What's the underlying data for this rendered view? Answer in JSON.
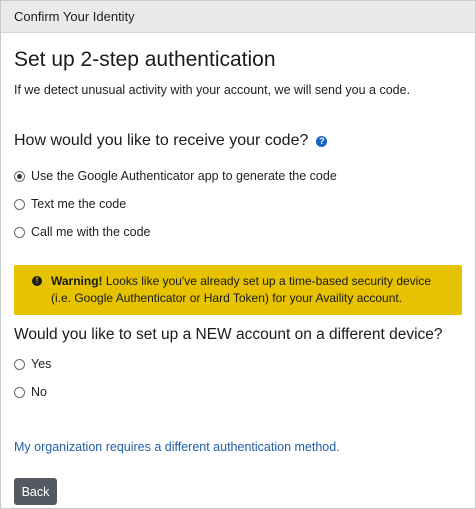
{
  "window": {
    "title": "Confirm Your Identity"
  },
  "header": {
    "title": "Set up 2-step authentication",
    "subtitle": "If we detect unusual activity with your account, we will send you a code."
  },
  "delivery": {
    "question": "How would you like to receive your code?",
    "help_icon": "question-circle-icon",
    "options": [
      {
        "label": "Use the Google Authenticator app to generate the code",
        "checked": true
      },
      {
        "label": "Text me the code",
        "checked": false
      },
      {
        "label": "Call me with the code",
        "checked": false
      }
    ]
  },
  "warning": {
    "icon": "exclamation-circle-icon",
    "strong": "Warning!",
    "text": " Looks like you've already set up a time-based security device (i.e. Google Authenticator or Hard Token) for your Availity account.",
    "color": "#e6c200"
  },
  "new_device": {
    "question": "Would you like to set up a NEW account on a different device?",
    "options": [
      {
        "label": "Yes",
        "checked": false
      },
      {
        "label": "No",
        "checked": false
      }
    ]
  },
  "alt_method_link": "My organization requires a different authentication method.",
  "actions": {
    "back_label": "Back"
  },
  "colors": {
    "link": "#1f5fa8",
    "button": "#535a61",
    "titlebar": "#e8eaec"
  }
}
